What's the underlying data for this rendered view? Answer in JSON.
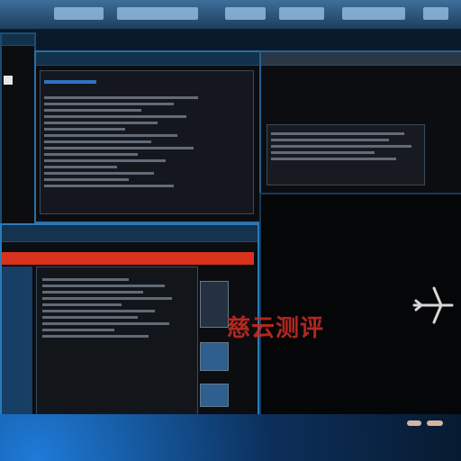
{
  "watermark": {
    "text": "慈云测评"
  },
  "colors": {
    "accent": "#2b6fa6",
    "alert": "#d8321c",
    "background": "#0a1a2a"
  }
}
